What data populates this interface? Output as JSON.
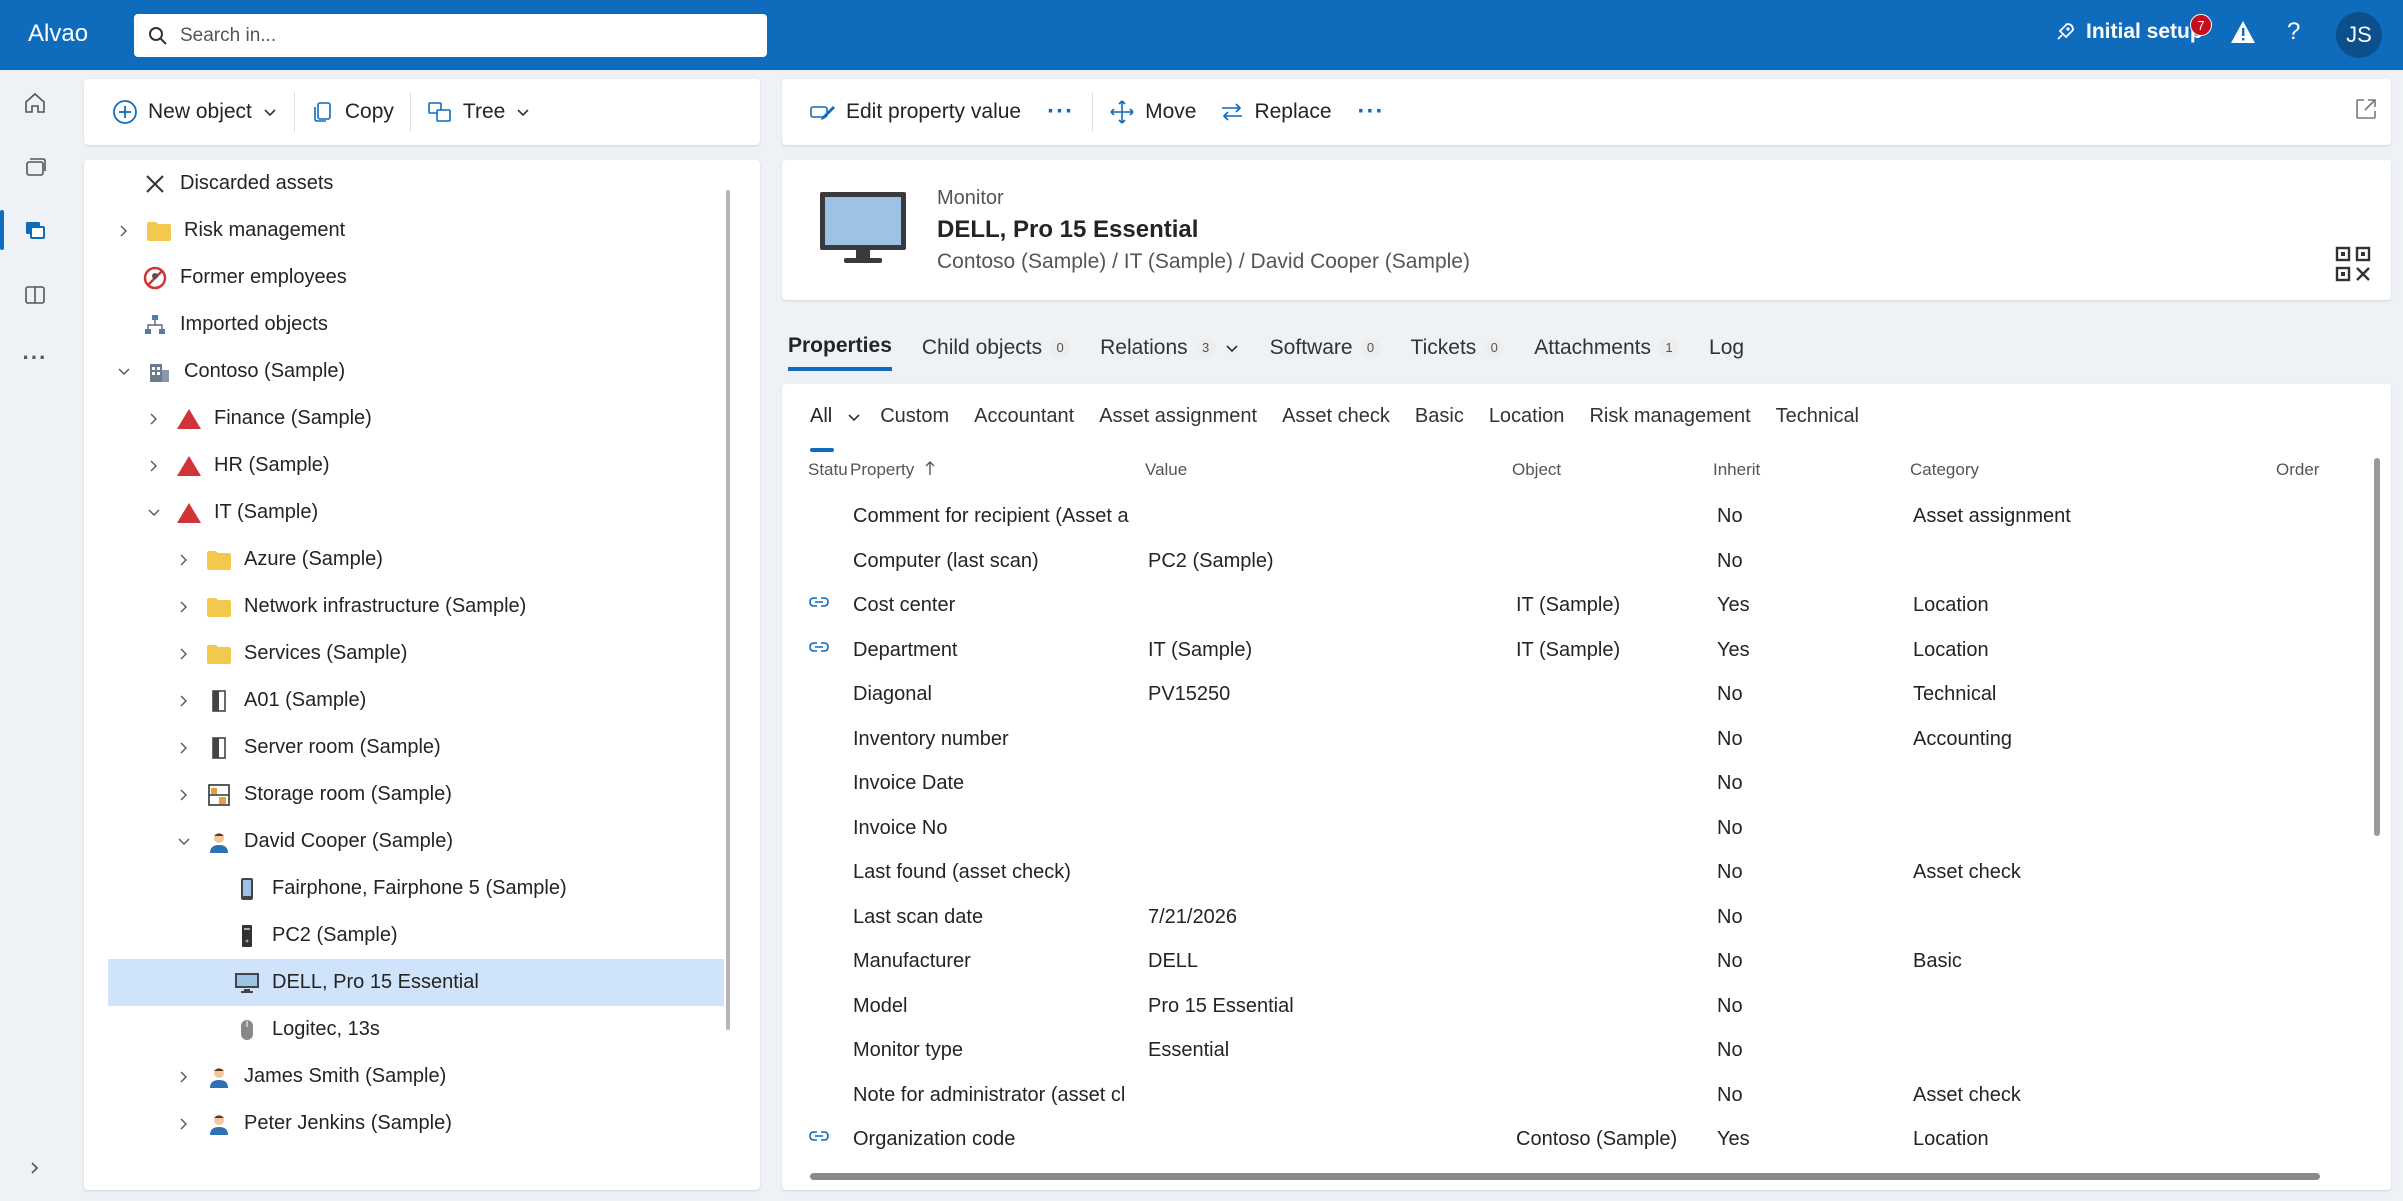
{
  "app": {
    "brand": "Alvao"
  },
  "search": {
    "placeholder": "Search in..."
  },
  "header": {
    "setup_label": "Initial setup",
    "notification_count": "7",
    "help": "?",
    "user_initials": "JS"
  },
  "left_toolbar": {
    "new_object": "New object",
    "copy": "Copy",
    "tree": "Tree"
  },
  "right_toolbar": {
    "edit_property_value": "Edit property value",
    "more1": "···",
    "move": "Move",
    "replace": "Replace",
    "more2": "···"
  },
  "tree": {
    "items": [
      {
        "label": "Discarded assets",
        "icon": "discarded-icon"
      },
      {
        "label": "Risk management",
        "icon": "folder-icon"
      },
      {
        "label": "Former employees",
        "icon": "prohibited-icon"
      },
      {
        "label": "Imported objects",
        "icon": "org-structure-icon"
      },
      {
        "label": "Contoso (Sample)",
        "icon": "building-icon"
      },
      {
        "label": "Finance (Sample)",
        "icon": "department-icon"
      },
      {
        "label": "HR (Sample)",
        "icon": "department-icon"
      },
      {
        "label": "IT (Sample)",
        "icon": "department-icon"
      },
      {
        "label": "Azure (Sample)",
        "icon": "folder-icon"
      },
      {
        "label": "Network infrastructure (Sample)",
        "icon": "folder-icon"
      },
      {
        "label": "Services (Sample)",
        "icon": "folder-icon"
      },
      {
        "label": "A01 (Sample)",
        "icon": "door-icon"
      },
      {
        "label": "Server room (Sample)",
        "icon": "door-icon"
      },
      {
        "label": "Storage room (Sample)",
        "icon": "shelf-icon"
      },
      {
        "label": "David Cooper (Sample)",
        "icon": "person-icon"
      },
      {
        "label": "Fairphone, Fairphone 5 (Sample)",
        "icon": "phone-icon"
      },
      {
        "label": "PC2 (Sample)",
        "icon": "pc-tower-icon"
      },
      {
        "label": "DELL, Pro 15 Essential",
        "icon": "monitor-icon"
      },
      {
        "label": "Logitec, 13s",
        "icon": "mouse-icon"
      },
      {
        "label": "James Smith (Sample)",
        "icon": "person-icon"
      },
      {
        "label": "Peter Jenkins (Sample)",
        "icon": "person-icon"
      }
    ]
  },
  "object": {
    "type": "Monitor",
    "name": "DELL, Pro 15 Essential",
    "path": "Contoso (Sample) / IT (Sample) / David Cooper (Sample)"
  },
  "tabs": [
    {
      "label": "Properties",
      "count": ""
    },
    {
      "label": "Child objects",
      "count": "0"
    },
    {
      "label": "Relations",
      "count": "3"
    },
    {
      "label": "Software",
      "count": "0"
    },
    {
      "label": "Tickets",
      "count": "0"
    },
    {
      "label": "Attachments",
      "count": "1"
    },
    {
      "label": "Log",
      "count": ""
    }
  ],
  "filters": [
    "All",
    "Custom",
    "Accountant",
    "Asset assignment",
    "Asset check",
    "Basic",
    "Location",
    "Risk management",
    "Technical"
  ],
  "grid": {
    "columns": {
      "status": "Statu",
      "property": "Property",
      "value": "Value",
      "object": "Object",
      "inherit": "Inherit",
      "category": "Category",
      "order": "Order"
    },
    "rows": [
      {
        "property": "Comment for recipient (Asset a",
        "value": "",
        "object": "",
        "inherit": "No",
        "category": "Asset assignment",
        "linked": false
      },
      {
        "property": "Computer (last scan)",
        "value": "PC2 (Sample)",
        "object": "",
        "inherit": "No",
        "category": "",
        "linked": false
      },
      {
        "property": "Cost center",
        "value": "",
        "object": "IT (Sample)",
        "inherit": "Yes",
        "category": "Location",
        "linked": true
      },
      {
        "property": "Department",
        "value": "IT (Sample)",
        "object": "IT (Sample)",
        "inherit": "Yes",
        "category": "Location",
        "linked": true
      },
      {
        "property": "Diagonal",
        "value": "PV15250",
        "object": "",
        "inherit": "No",
        "category": "Technical",
        "linked": false
      },
      {
        "property": "Inventory number",
        "value": "",
        "object": "",
        "inherit": "No",
        "category": "Accounting",
        "linked": false
      },
      {
        "property": "Invoice Date",
        "value": "",
        "object": "",
        "inherit": "No",
        "category": "",
        "linked": false
      },
      {
        "property": "Invoice No",
        "value": "",
        "object": "",
        "inherit": "No",
        "category": "",
        "linked": false
      },
      {
        "property": "Last found (asset check)",
        "value": "",
        "object": "",
        "inherit": "No",
        "category": "Asset check",
        "linked": false
      },
      {
        "property": "Last scan date",
        "value": "7/21/2026",
        "object": "",
        "inherit": "No",
        "category": "",
        "linked": false
      },
      {
        "property": "Manufacturer",
        "value": "DELL",
        "object": "",
        "inherit": "No",
        "category": "Basic",
        "linked": false
      },
      {
        "property": "Model",
        "value": "Pro 15 Essential",
        "object": "",
        "inherit": "No",
        "category": "",
        "linked": false
      },
      {
        "property": "Monitor type",
        "value": "Essential",
        "object": "",
        "inherit": "No",
        "category": "",
        "linked": false
      },
      {
        "property": "Note for administrator (asset cl",
        "value": "",
        "object": "",
        "inherit": "No",
        "category": "Asset check",
        "linked": false
      },
      {
        "property": "Organization code",
        "value": "",
        "object": "Contoso (Sample)",
        "inherit": "Yes",
        "category": "Location",
        "linked": true
      }
    ]
  }
}
